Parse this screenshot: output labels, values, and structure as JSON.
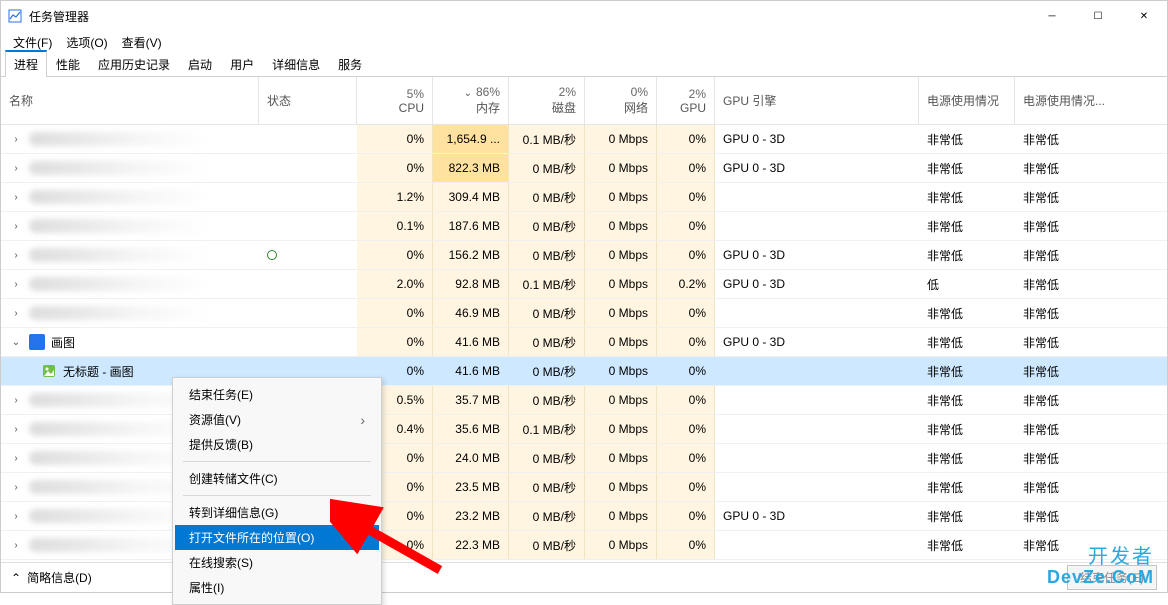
{
  "window": {
    "title": "任务管理器"
  },
  "menubar": [
    "文件(F)",
    "选项(O)",
    "查看(V)"
  ],
  "tabs": [
    "进程",
    "性能",
    "应用历史记录",
    "启动",
    "用户",
    "详细信息",
    "服务"
  ],
  "active_tab": 0,
  "headers": {
    "name": "名称",
    "status": "状态",
    "cpu": {
      "pct": "5%",
      "label": "CPU"
    },
    "mem": {
      "pct": "86%",
      "label": "内存"
    },
    "disk": {
      "pct": "2%",
      "label": "磁盘"
    },
    "net": {
      "pct": "0%",
      "label": "网络"
    },
    "gpu": {
      "pct": "2%",
      "label": "GPU"
    },
    "engine": "GPU 引擎",
    "power": "电源使用情况",
    "trend": "电源使用情况..."
  },
  "app": {
    "name": "画图",
    "child": "无标题 - 画图"
  },
  "rows": [
    {
      "cpu": "0%",
      "mem": "1,654.9 ...",
      "disk": "0.1 MB/秒",
      "net": "0 Mbps",
      "gpu": "0%",
      "engine": "GPU 0 - 3D",
      "power": "非常低",
      "trend": "非常低",
      "mem_bright": true
    },
    {
      "cpu": "0%",
      "mem": "822.3 MB",
      "disk": "0 MB/秒",
      "net": "0 Mbps",
      "gpu": "0%",
      "engine": "GPU 0 - 3D",
      "power": "非常低",
      "trend": "非常低",
      "mem_bright": true
    },
    {
      "cpu": "1.2%",
      "mem": "309.4 MB",
      "disk": "0 MB/秒",
      "net": "0 Mbps",
      "gpu": "0%",
      "engine": "",
      "power": "非常低",
      "trend": "非常低"
    },
    {
      "cpu": "0.1%",
      "mem": "187.6 MB",
      "disk": "0 MB/秒",
      "net": "0 Mbps",
      "gpu": "0%",
      "engine": "",
      "power": "非常低",
      "trend": "非常低"
    },
    {
      "cpu": "0%",
      "mem": "156.2 MB",
      "disk": "0 MB/秒",
      "net": "0 Mbps",
      "gpu": "0%",
      "engine": "GPU 0 - 3D",
      "power": "非常低",
      "trend": "非常低",
      "leaf": true
    },
    {
      "cpu": "2.0%",
      "mem": "92.8 MB",
      "disk": "0.1 MB/秒",
      "net": "0 Mbps",
      "gpu": "0.2%",
      "engine": "GPU 0 - 3D",
      "power": "低",
      "trend": "非常低"
    },
    {
      "cpu": "0%",
      "mem": "46.9 MB",
      "disk": "0 MB/秒",
      "net": "0 Mbps",
      "gpu": "0%",
      "engine": "",
      "power": "非常低",
      "trend": "非常低"
    },
    {
      "cpu": "0%",
      "mem": "41.6 MB",
      "disk": "0 MB/秒",
      "net": "0 Mbps",
      "gpu": "0%",
      "engine": "GPU 0 - 3D",
      "power": "非常低",
      "trend": "非常低",
      "is_app_parent": true
    },
    {
      "cpu": "0%",
      "mem": "41.6 MB",
      "disk": "0 MB/秒",
      "net": "0 Mbps",
      "gpu": "0%",
      "engine": "",
      "power": "非常低",
      "trend": "非常低",
      "is_app_child": true,
      "selected": true
    },
    {
      "cpu": "0.5%",
      "mem": "35.7 MB",
      "disk": "0 MB/秒",
      "net": "0 Mbps",
      "gpu": "0%",
      "engine": "",
      "power": "非常低",
      "trend": "非常低"
    },
    {
      "cpu": "0.4%",
      "mem": "35.6 MB",
      "disk": "0.1 MB/秒",
      "net": "0 Mbps",
      "gpu": "0%",
      "engine": "",
      "power": "非常低",
      "trend": "非常低"
    },
    {
      "cpu": "0%",
      "mem": "24.0 MB",
      "disk": "0 MB/秒",
      "net": "0 Mbps",
      "gpu": "0%",
      "engine": "",
      "power": "非常低",
      "trend": "非常低"
    },
    {
      "cpu": "0%",
      "mem": "23.5 MB",
      "disk": "0 MB/秒",
      "net": "0 Mbps",
      "gpu": "0%",
      "engine": "",
      "power": "非常低",
      "trend": "非常低"
    },
    {
      "cpu": "0%",
      "mem": "23.2 MB",
      "disk": "0 MB/秒",
      "net": "0 Mbps",
      "gpu": "0%",
      "engine": "GPU 0 - 3D",
      "power": "非常低",
      "trend": "非常低"
    },
    {
      "cpu": "0%",
      "mem": "22.3 MB",
      "disk": "0 MB/秒",
      "net": "0 Mbps",
      "gpu": "0%",
      "engine": "",
      "power": "非常低",
      "trend": "非常低",
      "partial": true
    }
  ],
  "context_menu": {
    "items": [
      {
        "label": "结束任务(E)"
      },
      {
        "label": "资源值(V)",
        "submenu": true
      },
      {
        "label": "提供反馈(B)"
      },
      {
        "sep": true
      },
      {
        "label": "创建转储文件(C)"
      },
      {
        "sep": true
      },
      {
        "label": "转到详细信息(G)"
      },
      {
        "label": "打开文件所在的位置(O)",
        "selected": true
      },
      {
        "label": "在线搜索(S)"
      },
      {
        "label": "属性(I)"
      }
    ]
  },
  "statusbar": {
    "fewer_details": "简略信息(D)",
    "end_task": "结束任务(E)"
  },
  "watermark": {
    "line1": "开发者",
    "line2": "DevZe.CoM"
  }
}
